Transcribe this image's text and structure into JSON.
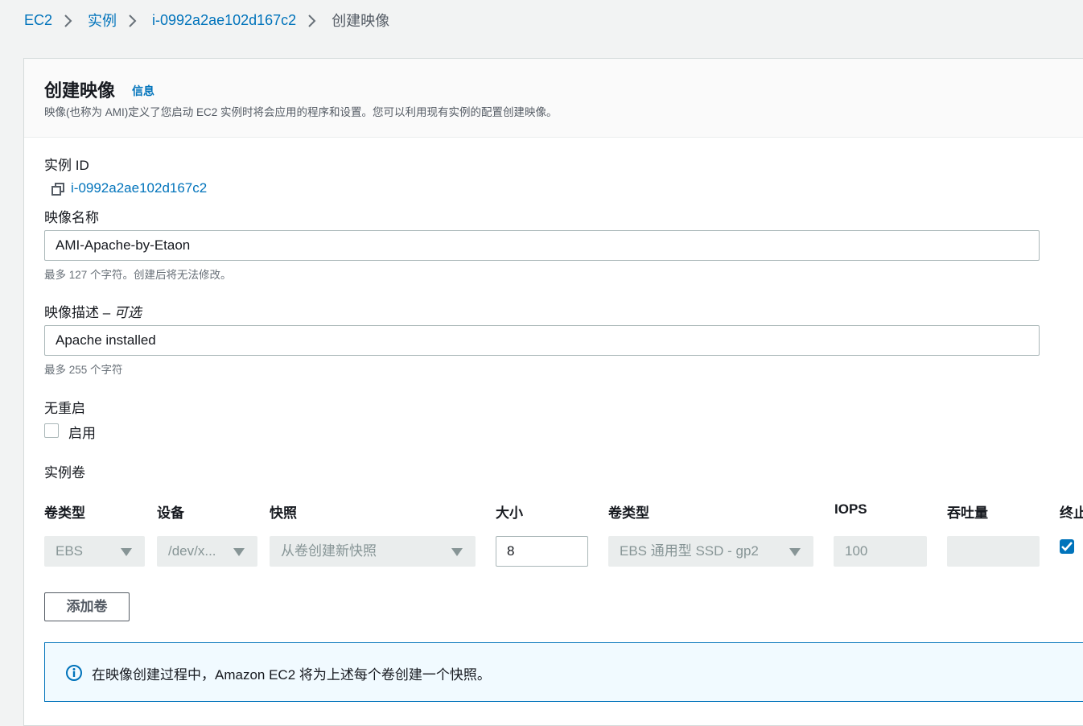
{
  "breadcrumb": {
    "items": [
      "EC2",
      "实例",
      "i-0992a2ae102d167c2"
    ],
    "current": "创建映像"
  },
  "header": {
    "title": "创建映像",
    "info_link": "信息",
    "description": "映像(也称为 AMI)定义了您启动 EC2 实例时将会应用的程序和设置。您可以利用现有实例的配置创建映像。"
  },
  "instance": {
    "label": "实例 ID",
    "id": "i-0992a2ae102d167c2"
  },
  "image_name": {
    "label": "映像名称",
    "value": "AMI-Apache-by-Etaon",
    "hint": "最多 127 个字符。创建后将无法修改。"
  },
  "image_description": {
    "label": "映像描述 – ",
    "optional": "可选",
    "value": "Apache installed",
    "hint": "最多 255 个字符"
  },
  "no_reboot": {
    "label": "无重启",
    "checkbox_label": "启用",
    "checked": false
  },
  "volumes": {
    "section_label": "实例卷",
    "columns": [
      "卷类型",
      "设备",
      "快照",
      "大小",
      "卷类型",
      "IOPS",
      "吞吐量",
      "终止"
    ],
    "row": {
      "volume_type": "EBS",
      "device": "/dev/x...",
      "snapshot": "从卷创建新快照",
      "size": "8",
      "ebs_type": "EBS 通用型 SSD - gp2",
      "iops": "100",
      "throughput": "",
      "delete_on_termination": true
    },
    "add_button": "添加卷"
  },
  "alert": {
    "text": "在映像创建过程中，Amazon EC2 将为上述每个卷创建一个快照。"
  },
  "colors": {
    "link": "#0073bb",
    "background": "#f2f3f3",
    "alert_bg": "#f1faff"
  }
}
